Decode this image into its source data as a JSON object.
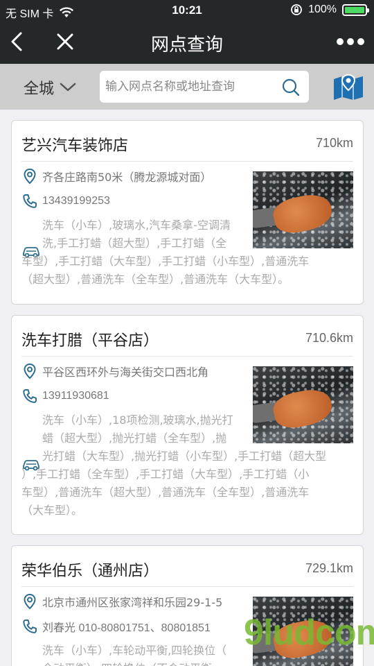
{
  "status_bar": {
    "carrier": "无 SIM 卡",
    "time": "10:21",
    "battery": "100%",
    "battery_level": 1.0
  },
  "nav": {
    "title": "网点查询"
  },
  "search": {
    "city": "全城",
    "placeholder": "输入网点名称或地址查询"
  },
  "stores": [
    {
      "name": "艺兴汽车装饰店",
      "distance": "710km",
      "address": "齐各庄路南50米（腾龙源城对面）",
      "phone": "13439199253",
      "services_lines": [
        "洗车（小车）,玻璃水,汽车桑拿-空调清",
        "洗,手工打蜡（超大型）,手工打蜡（全",
        "车型）,手工打蜡（大车型）,手工打蜡（小车型）,普通洗车",
        "（超大型）,普通洗车（全车型）,普通洗车（大车型）。"
      ]
    },
    {
      "name": "洗车打腊（平谷店）",
      "distance": "710.6km",
      "address": "平谷区西环外与海关街交口西北角",
      "phone": "13911930681",
      "services_lines": [
        "洗车（小车）,18项检测,玻璃水,抛光打",
        "蜡（超大型）,抛光打蜡（全车型）,抛",
        "光打蜡（大车型）,抛光打蜡（小车型）,手工打蜡（超大型",
        "）,手工打蜡（全车型）,手工打蜡（大车型）,手工打蜡（小",
        "车型）,普通洗车（超大型）,普通洗车（全车型）,普通洗车",
        "（大车型）。"
      ]
    },
    {
      "name": "荣华伯乐（通州店）",
      "distance": "729.1km",
      "address": "北京市通州区张家湾祥和乐园29-1-5",
      "phone": "刘春光 010-80801751、80801851",
      "services_lines": [
        "洗车（小车）,车轮动平衡,四轮换位（",
        "全动平衡）,四轮换位（不含动平衡"
      ]
    }
  ],
  "watermark": "9ludcom",
  "colors": {
    "bar_bg": "#252829",
    "search_bg": "#cdcdcd",
    "icon_blue": "#2d6d8f",
    "map_blue": "#1f6fb3",
    "battery_green": "#4cd964"
  }
}
